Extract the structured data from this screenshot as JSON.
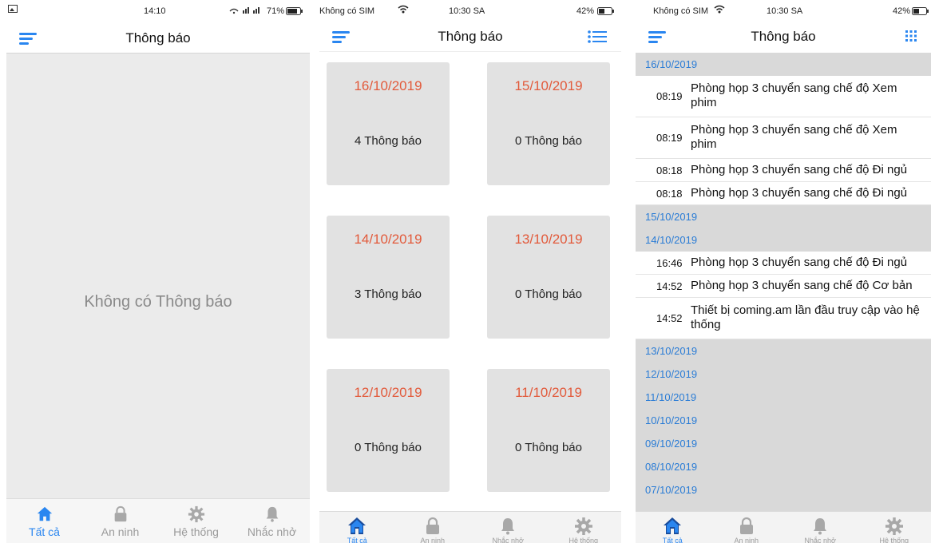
{
  "colors": {
    "accent": "#2a86f0",
    "date_red": "#e25a3b",
    "date_blue": "#2a7cd6",
    "inactive": "#9a9a9a"
  },
  "screen1": {
    "status": {
      "time": "14:10",
      "battery": "71%"
    },
    "title": "Thông báo",
    "empty_text": "Không có Thông báo",
    "tabs": [
      {
        "label": "Tất cả",
        "icon": "home-icon"
      },
      {
        "label": "An ninh",
        "icon": "lock-icon"
      },
      {
        "label": "Hệ thống",
        "icon": "gear-icon"
      },
      {
        "label": "Nhắc nhở",
        "icon": "bell-icon"
      }
    ]
  },
  "screen2": {
    "status": {
      "carrier": "Không có SIM",
      "time": "10:30 SA",
      "battery": "42%"
    },
    "title": "Thông báo",
    "cards": [
      {
        "date": "16/10/2019",
        "count": "4 Thông báo"
      },
      {
        "date": "15/10/2019",
        "count": "0 Thông báo"
      },
      {
        "date": "14/10/2019",
        "count": "3 Thông báo"
      },
      {
        "date": "13/10/2019",
        "count": "0 Thông báo"
      },
      {
        "date": "12/10/2019",
        "count": "0 Thông báo"
      },
      {
        "date": "11/10/2019",
        "count": "0 Thông báo"
      }
    ],
    "tabs": [
      {
        "label": "Tất cả",
        "icon": "home-icon"
      },
      {
        "label": "An ninh",
        "icon": "lock-icon"
      },
      {
        "label": "Nhắc nhở",
        "icon": "bell-icon"
      },
      {
        "label": "Hệ thống",
        "icon": "gear-icon"
      }
    ]
  },
  "screen3": {
    "status": {
      "carrier": "Không có SIM",
      "time": "10:30 SA",
      "battery": "42%"
    },
    "title": "Thông báo",
    "groups": [
      {
        "date": "16/10/2019",
        "items": [
          {
            "time": "08:19",
            "text": "Phòng họp 3 chuyển sang chế độ Xem phim"
          },
          {
            "time": "08:19",
            "text": "Phòng họp 3 chuyển sang chế độ Xem phim"
          },
          {
            "time": "08:18",
            "text": "Phòng họp 3 chuyển sang chế độ Đi ngủ"
          },
          {
            "time": "08:18",
            "text": "Phòng họp 3 chuyển sang chế độ Đi ngủ"
          }
        ]
      },
      {
        "date": "15/10/2019",
        "items": []
      },
      {
        "date": "14/10/2019",
        "items": [
          {
            "time": "16:46",
            "text": "Phòng họp 3 chuyển sang chế độ Đi ngủ"
          },
          {
            "time": "14:52",
            "text": "Phòng họp 3 chuyển sang chế độ Cơ bản"
          },
          {
            "time": "14:52",
            "text": "Thiết bị coming.am lần đầu truy cập vào hệ thống"
          }
        ]
      },
      {
        "date": "13/10/2019",
        "items": []
      },
      {
        "date": "12/10/2019",
        "items": []
      },
      {
        "date": "11/10/2019",
        "items": []
      },
      {
        "date": "10/10/2019",
        "items": []
      },
      {
        "date": "09/10/2019",
        "items": []
      },
      {
        "date": "08/10/2019",
        "items": []
      },
      {
        "date": "07/10/2019",
        "items": []
      }
    ],
    "tabs": [
      {
        "label": "Tất cả",
        "icon": "home-icon"
      },
      {
        "label": "An ninh",
        "icon": "lock-icon"
      },
      {
        "label": "Nhắc nhở",
        "icon": "bell-icon"
      },
      {
        "label": "Hệ thống",
        "icon": "gear-icon"
      }
    ]
  }
}
